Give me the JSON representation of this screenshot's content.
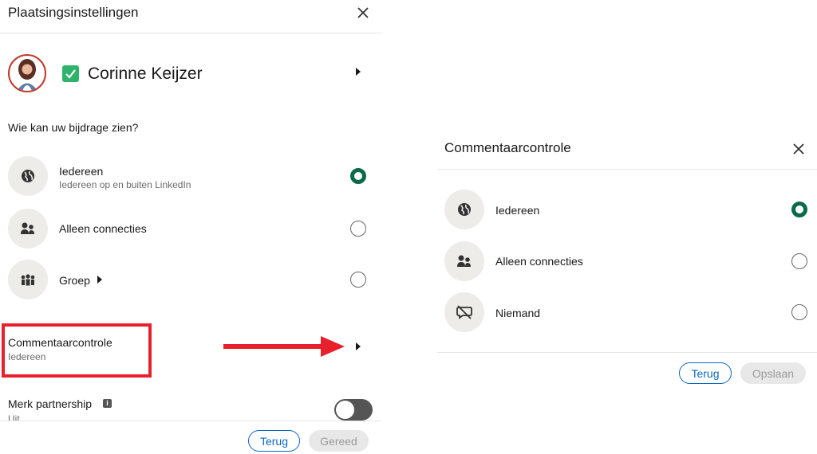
{
  "left_panel": {
    "title": "Plaatsingsinstellingen",
    "author_name": "Corinne Keijzer",
    "visibility_question": "Wie kan uw bijdrage zien?",
    "options": [
      {
        "label": "Iedereen",
        "sub": "Iedereen op en buiten LinkedIn",
        "icon": "globe-icon",
        "selected": true
      },
      {
        "label": "Alleen connecties",
        "sub": "",
        "icon": "people-icon",
        "selected": false
      },
      {
        "label": "Groep",
        "sub": "",
        "icon": "group-icon",
        "selected": false
      }
    ],
    "comment_control_label": "Commentaarcontrole",
    "comment_control_value": "Iedereen",
    "brand_partnership_label": "Merk partnership",
    "brand_partnership_value": "Uit",
    "back_label": "Terug",
    "done_label": "Gereed"
  },
  "right_panel": {
    "title": "Commentaarcontrole",
    "options": [
      {
        "label": "Iedereen",
        "icon": "globe-icon",
        "selected": true
      },
      {
        "label": "Alleen connecties",
        "icon": "people-icon",
        "selected": false
      },
      {
        "label": "Niemand",
        "icon": "no-comment-icon",
        "selected": false
      }
    ],
    "back_label": "Terug",
    "save_label": "Opslaan"
  },
  "colors": {
    "accent_green": "#0a6b4a",
    "link_blue": "#0a66c2",
    "annotation_red": "#e8202e",
    "checkbox_green": "#2fb36a"
  }
}
